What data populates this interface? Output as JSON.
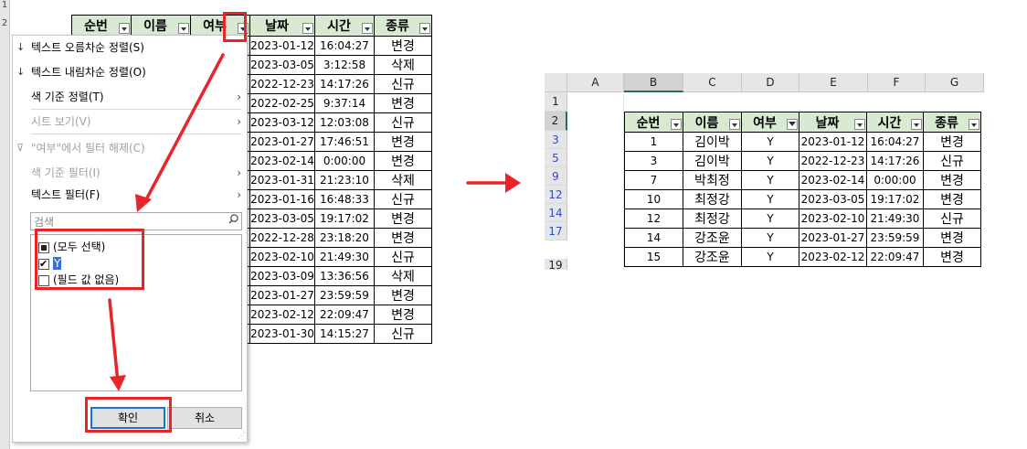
{
  "left": {
    "row_headers_visible": [
      "1",
      "2"
    ],
    "headers": [
      "순번",
      "이름",
      "여부",
      "날짜",
      "시간",
      "종류"
    ],
    "rows": [
      [
        "2023-01-12",
        "16:04:27",
        "변경"
      ],
      [
        "2023-03-05",
        "3:12:58",
        "삭제"
      ],
      [
        "2022-12-23",
        "14:17:26",
        "신규"
      ],
      [
        "2022-02-25",
        "9:37:14",
        "변경"
      ],
      [
        "2023-03-12",
        "12:03:08",
        "신규"
      ],
      [
        "2023-01-27",
        "17:46:51",
        "변경"
      ],
      [
        "2023-02-14",
        "0:00:00",
        "변경"
      ],
      [
        "2023-01-31",
        "21:23:10",
        "삭제"
      ],
      [
        "2023-01-16",
        "16:48:33",
        "신규"
      ],
      [
        "2023-03-05",
        "19:17:02",
        "변경"
      ],
      [
        "2022-12-28",
        "23:18:20",
        "변경"
      ],
      [
        "2023-02-10",
        "21:49:30",
        "신규"
      ],
      [
        "2023-03-09",
        "13:36:56",
        "삭제"
      ],
      [
        "2023-01-27",
        "23:59:59",
        "변경"
      ],
      [
        "2023-02-12",
        "22:09:47",
        "변경"
      ],
      [
        "2023-01-30",
        "14:15:27",
        "신규"
      ]
    ],
    "menu": {
      "items": [
        {
          "icon": "↓",
          "label": "텍스트 오름차순 정렬(S)",
          "disabled": false,
          "submenu": false
        },
        {
          "icon": "↓",
          "label": "텍스트 내림차순 정렬(O)",
          "disabled": false,
          "submenu": false
        },
        {
          "icon": "",
          "label": "색 기준 정렬(T)",
          "disabled": false,
          "submenu": true
        },
        {
          "icon": "",
          "label": "시트 보기(V)",
          "disabled": true,
          "submenu": true
        },
        {
          "icon": "⊽",
          "label": "\"여부\"에서 필터 해제(C)",
          "disabled": true,
          "submenu": false
        },
        {
          "icon": "",
          "label": "색 기준 필터(I)",
          "disabled": true,
          "submenu": true
        },
        {
          "icon": "",
          "label": "텍스트 필터(F)",
          "disabled": false,
          "submenu": true
        }
      ],
      "search_placeholder": "검색",
      "list": [
        {
          "label": "(모두 선택)",
          "state": "partial"
        },
        {
          "label": "Y",
          "state": "checked"
        },
        {
          "label": "(필드 값 없음)",
          "state": "unchecked"
        }
      ],
      "ok_label": "확인",
      "cancel_label": "취소"
    }
  },
  "right": {
    "columns": [
      "A",
      "B",
      "C",
      "D",
      "E",
      "F",
      "G"
    ],
    "row_numbers": [
      "1",
      "2",
      "3",
      "5",
      "9",
      "12",
      "14",
      "17",
      "19"
    ],
    "headers": [
      "순번",
      "이름",
      "여부",
      "날짜",
      "시간",
      "종류"
    ],
    "rows": [
      [
        "1",
        "김이박",
        "Y",
        "2023-01-12",
        "16:04:27",
        "변경"
      ],
      [
        "3",
        "김이박",
        "Y",
        "2022-12-23",
        "14:17:26",
        "신규"
      ],
      [
        "7",
        "박최정",
        "Y",
        "2023-02-14",
        "0:00:00",
        "변경"
      ],
      [
        "10",
        "최정강",
        "Y",
        "2023-03-05",
        "19:17:02",
        "변경"
      ],
      [
        "12",
        "최정강",
        "Y",
        "2023-02-10",
        "21:49:30",
        "신규"
      ],
      [
        "14",
        "강조윤",
        "Y",
        "2023-01-27",
        "23:59:59",
        "변경"
      ],
      [
        "15",
        "강조윤",
        "Y",
        "2023-02-12",
        "22:09:47",
        "변경"
      ]
    ]
  },
  "colors": {
    "header_fill": "#d9ead3",
    "annotation_red": "#e8262a",
    "excel_green": "#217346",
    "filtered_row_blue": "#2b4fc7"
  }
}
